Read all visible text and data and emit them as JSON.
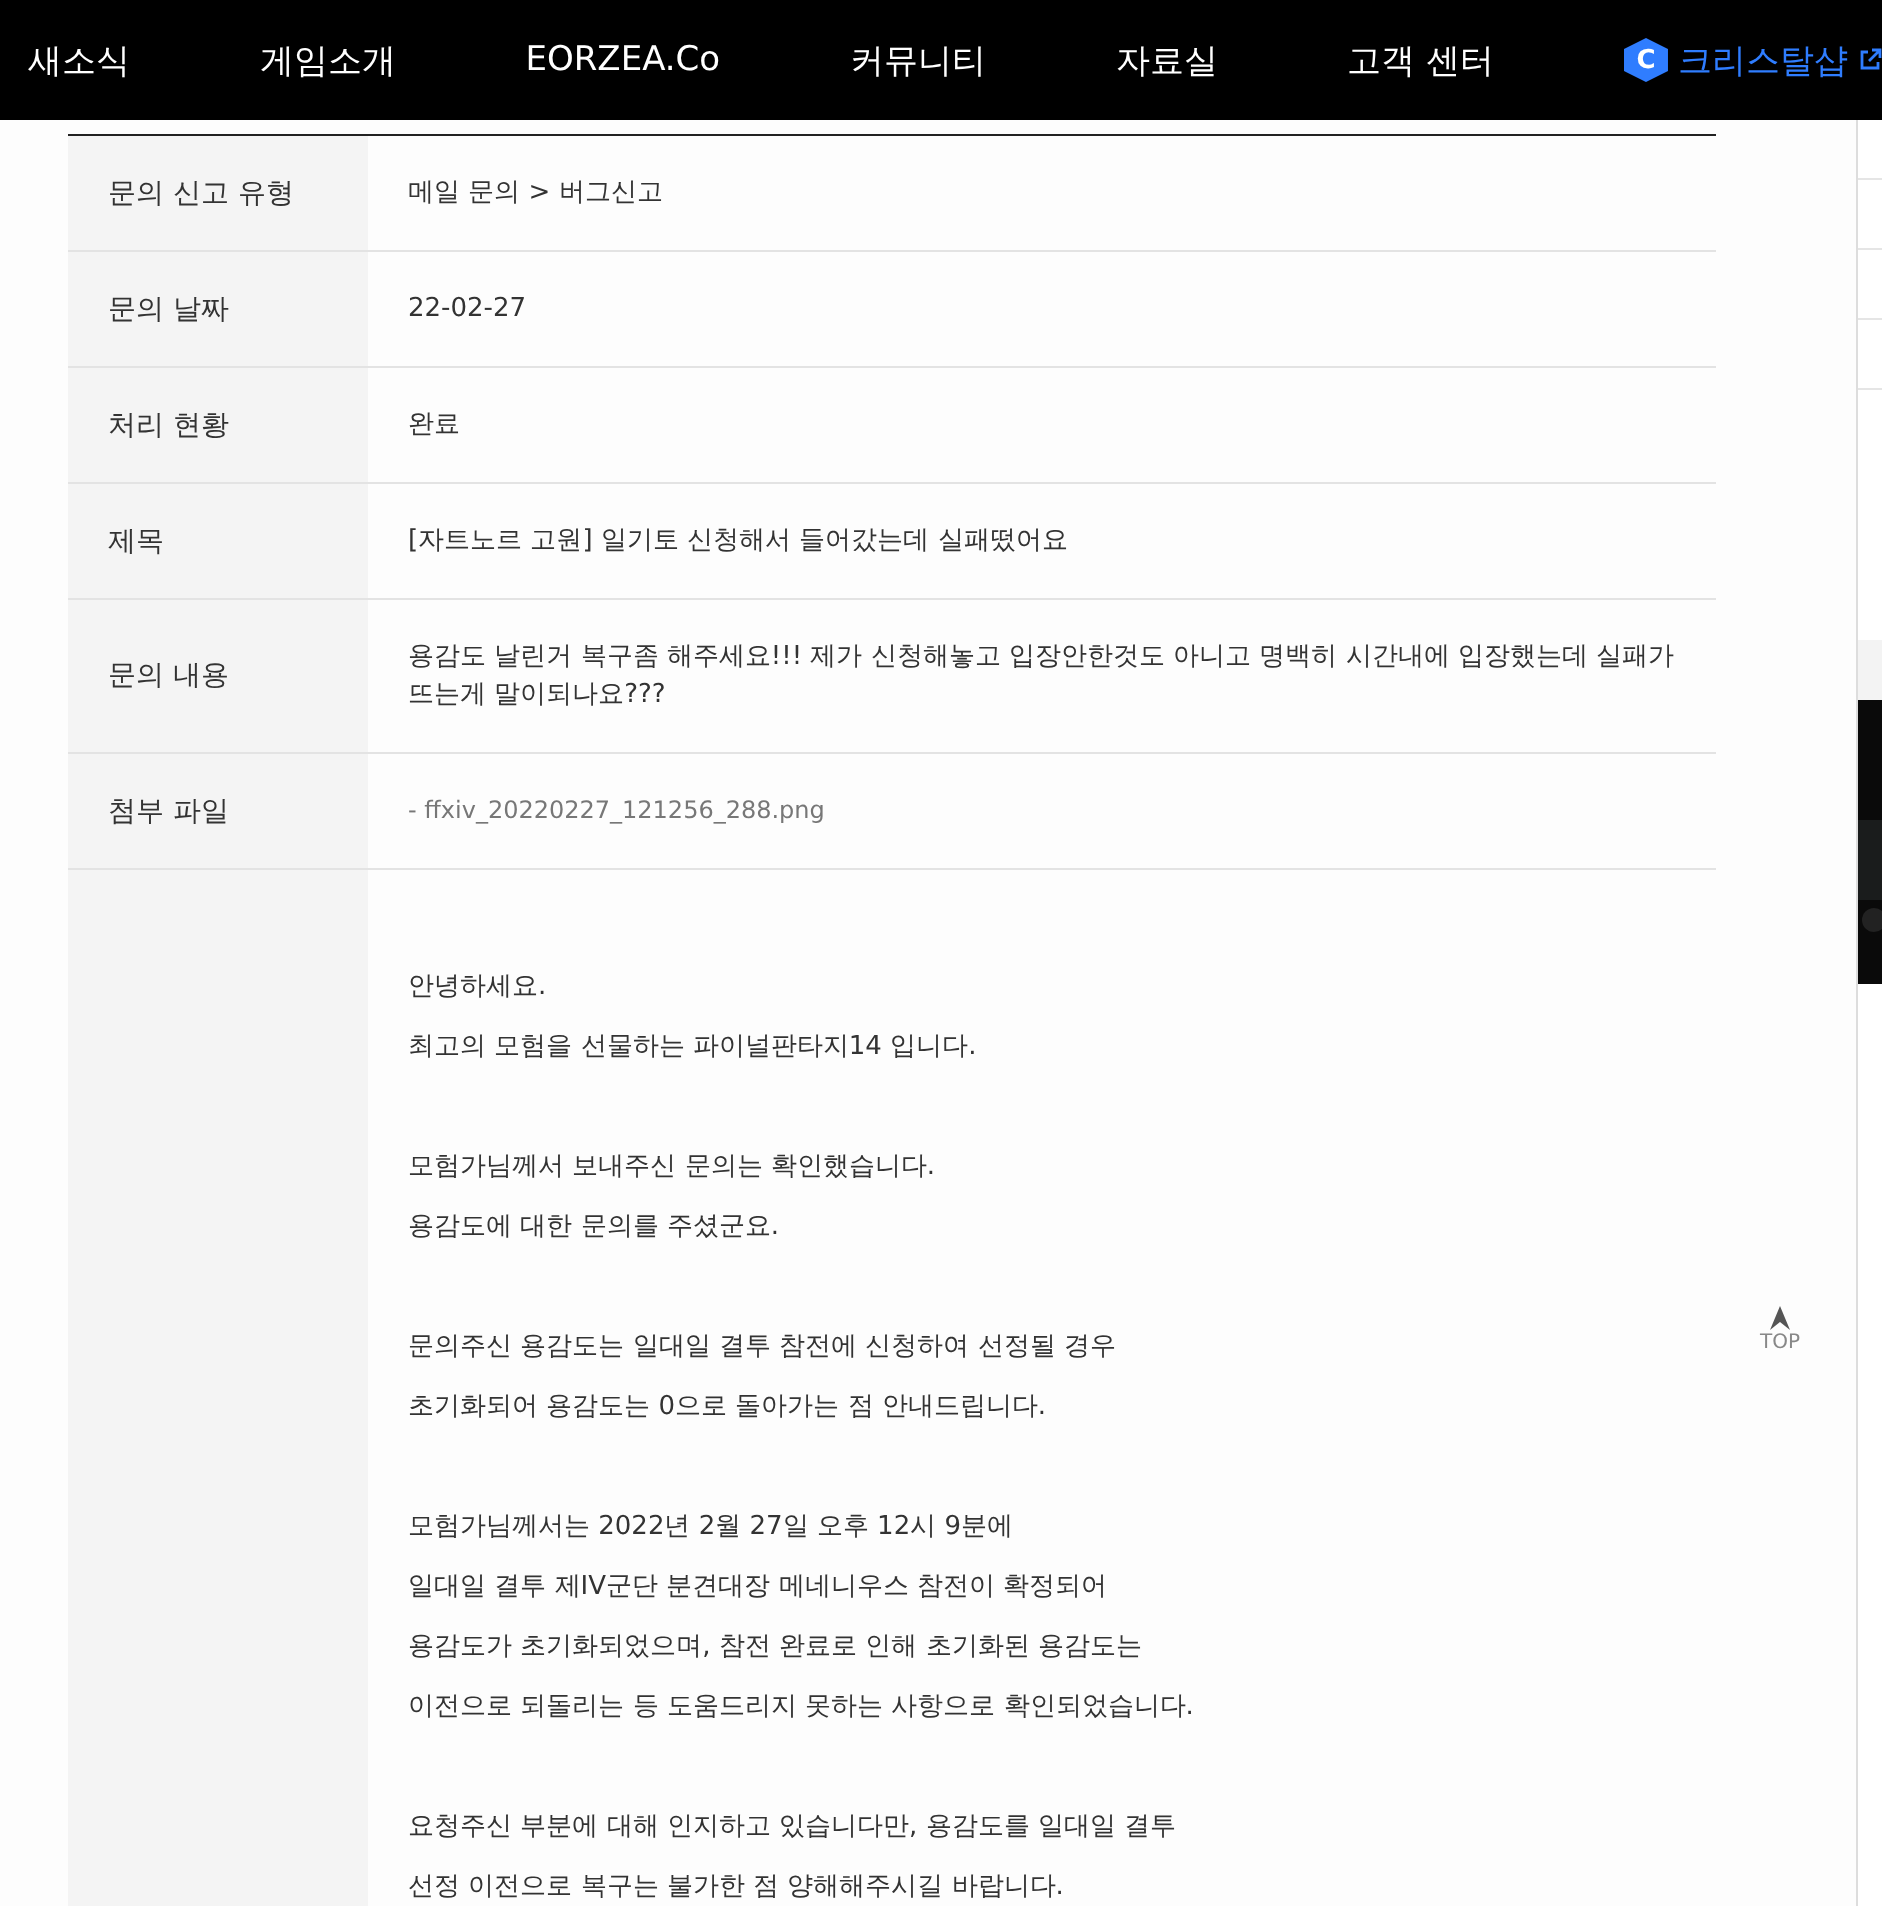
{
  "nav": {
    "items": [
      {
        "label": "새소식",
        "kind": "link"
      },
      {
        "label": "게임소개",
        "kind": "link"
      },
      {
        "label": "EORZEA.Co",
        "kind": "link"
      },
      {
        "label": "커뮤니티",
        "kind": "link"
      },
      {
        "label": "자료실",
        "kind": "link"
      },
      {
        "label": "고객 센터",
        "kind": "link"
      },
      {
        "label": "크리스탈샵",
        "kind": "shop",
        "badge": "C"
      }
    ]
  },
  "inquiry": {
    "rows": [
      {
        "label": "문의 신고 유형",
        "value": "메일 문의 > 버그신고",
        "kind": "text"
      },
      {
        "label": "문의 날짜",
        "value": "22-02-27",
        "kind": "text"
      },
      {
        "label": "처리 현황",
        "value": "완료",
        "kind": "text"
      },
      {
        "label": "제목",
        "value": "[자트노르 고원] 일기토 신청해서 들어갔는데 실패떴어요",
        "kind": "text"
      },
      {
        "label": "문의 내용",
        "value": "용감도 날린거 복구좀 해주세요!!! 제가 신청해놓고 입장안한것도 아니고 명백히 시간내에 입장했는데 실패가 뜨는게 말이되나요???",
        "kind": "text"
      },
      {
        "label": "첨부 파일",
        "value": "- ffxiv_20220227_121256_288.png",
        "kind": "file"
      }
    ],
    "answer": [
      [
        "안녕하세요.",
        "최고의 모험을 선물하는 파이널판타지14 입니다."
      ],
      [
        "모험가님께서 보내주신 문의는 확인했습니다.",
        "용감도에 대한 문의를 주셨군요."
      ],
      [
        "문의주신 용감도는 일대일 결투 참전에 신청하여 선정될 경우",
        "초기화되어 용감도는 0으로 돌아가는 점 안내드립니다."
      ],
      [
        "모험가님께서는 2022년 2월 27일 오후 12시 9분에",
        "일대일 결투 제IV군단 분견대장 메네니우스 참전이 확정되어",
        "용감도가 초기화되었으며, 참전 완료로 인해 초기화된 용감도는",
        "이전으로 되돌리는 등 도움드리지 못하는 사항으로 확인되었습니다."
      ],
      [
        "요청주신 부분에 대해 인지하고 있습니다만, 용감도를 일대일 결투",
        "선정 이전으로 복구는 불가한 점 양해해주시길 바랍니다."
      ]
    ]
  },
  "top_button": {
    "label": "TOP"
  }
}
